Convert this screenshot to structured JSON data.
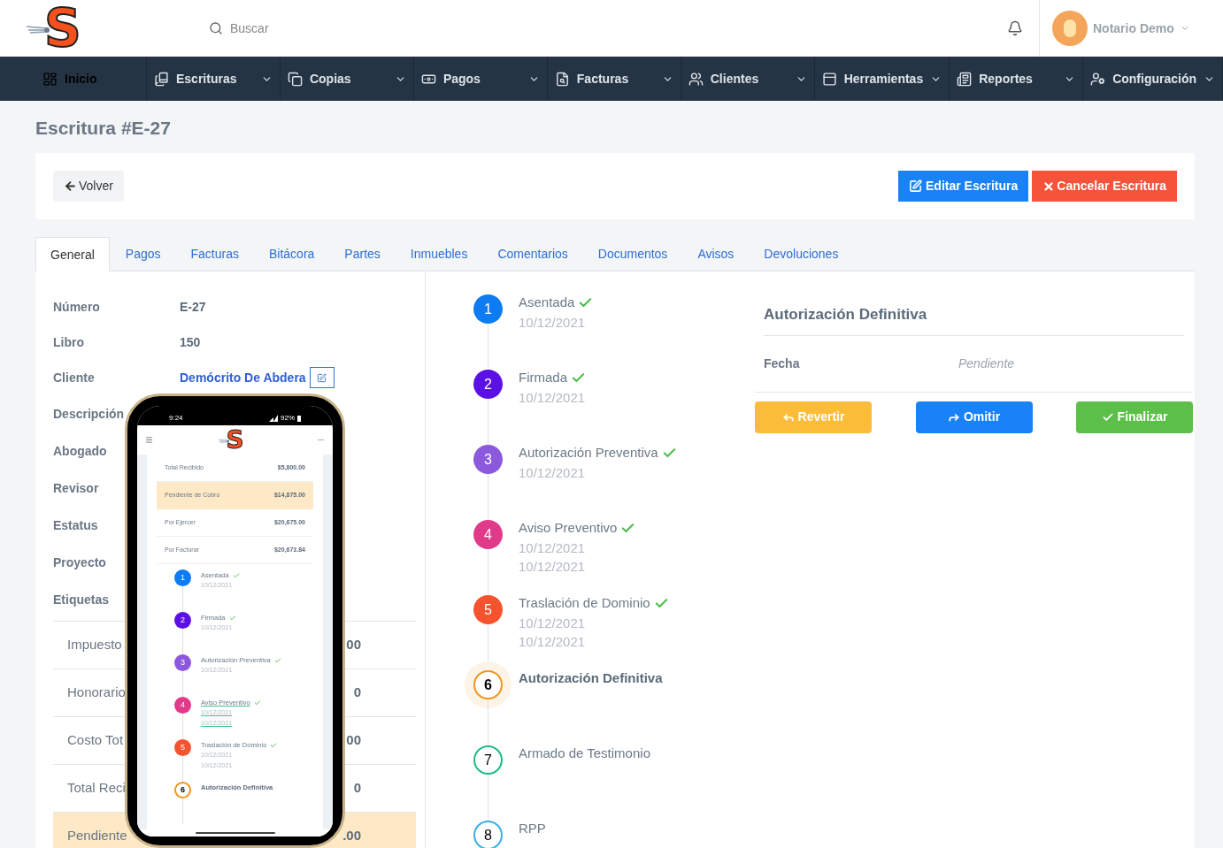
{
  "header": {
    "logo": "S",
    "search": {
      "placeholder": "Buscar"
    },
    "user": {
      "name": "Notario Demo"
    }
  },
  "nav": [
    {
      "label": "Inicio",
      "caret": false,
      "selected": true
    },
    {
      "label": "Escrituras",
      "caret": true,
      "selected": false
    },
    {
      "label": "Copias",
      "caret": true,
      "selected": false
    },
    {
      "label": "Pagos",
      "caret": true,
      "selected": false
    },
    {
      "label": "Facturas",
      "caret": true,
      "selected": false
    },
    {
      "label": "Clientes",
      "caret": true,
      "selected": false
    },
    {
      "label": "Herramientas",
      "caret": true,
      "selected": false
    },
    {
      "label": "Reportes",
      "caret": true,
      "selected": false
    },
    {
      "label": "Configuración",
      "caret": true,
      "selected": false
    }
  ],
  "page_title": "Escritura #E-27",
  "toolbar": {
    "back": "Volver",
    "edit": "Editar Escritura",
    "cancel": "Cancelar Escritura"
  },
  "tabs": [
    {
      "label": "General",
      "selected": true
    },
    {
      "label": "Pagos",
      "selected": false
    },
    {
      "label": "Facturas",
      "selected": false
    },
    {
      "label": "Bitácora",
      "selected": false
    },
    {
      "label": "Partes",
      "selected": false
    },
    {
      "label": "Inmuebles",
      "selected": false
    },
    {
      "label": "Comentarios",
      "selected": false
    },
    {
      "label": "Documentos",
      "selected": false
    },
    {
      "label": "Avisos",
      "selected": false
    },
    {
      "label": "Devoluciones",
      "selected": false
    }
  ],
  "details": [
    {
      "label": "Número",
      "value": "E-27",
      "kind": "text"
    },
    {
      "label": "Libro",
      "value": "150",
      "kind": "text"
    },
    {
      "label": "Cliente",
      "value": "Demócrito De Abdera",
      "kind": "link"
    },
    {
      "label": "Descripción",
      "kind": "empty"
    },
    {
      "label": "Abogado",
      "kind": "empty"
    },
    {
      "label": "Revisor",
      "kind": "empty"
    },
    {
      "label": "Estatus",
      "kind": "empty"
    },
    {
      "label": "Proyecto",
      "kind": "empty"
    },
    {
      "label": "Etiquetas",
      "kind": "empty"
    }
  ],
  "totals": [
    {
      "label": "Impuesto",
      "value": "00",
      "highlight": false
    },
    {
      "label": "Honorario",
      "value": "0",
      "highlight": false
    },
    {
      "label": "Costo Tot",
      "value": "00",
      "highlight": false
    },
    {
      "label": "Total Reci",
      "value": "0",
      "highlight": false
    },
    {
      "label": "Pendiente",
      "value": ".00",
      "highlight": true
    }
  ],
  "timeline": [
    {
      "number": "1",
      "title": "Asentada",
      "dates": [
        "10/12/2021"
      ],
      "done": true,
      "current": false,
      "filled": true,
      "color": "#0d7bf2"
    },
    {
      "number": "2",
      "title": "Firmada",
      "dates": [
        "10/12/2021"
      ],
      "done": true,
      "current": false,
      "filled": true,
      "color": "#5b10e6"
    },
    {
      "number": "3",
      "title": "Autorización Preventiva",
      "dates": [
        "10/12/2021"
      ],
      "done": true,
      "current": false,
      "filled": true,
      "color": "#8c58dc"
    },
    {
      "number": "4",
      "title": "Aviso Preventivo",
      "dates": [
        "10/12/2021",
        "10/12/2021"
      ],
      "done": true,
      "current": false,
      "filled": true,
      "color": "#e13a8b"
    },
    {
      "number": "5",
      "title": "Traslación de Dominio",
      "dates": [
        "10/12/2021",
        "10/12/2021"
      ],
      "done": true,
      "current": false,
      "filled": true,
      "color": "#f5532f"
    },
    {
      "number": "6",
      "title": "Autorización Definitiva",
      "done": false,
      "current": true,
      "filled": false,
      "color": "#f0961e"
    },
    {
      "number": "7",
      "title": "Armado de Testimonio",
      "done": false,
      "current": false,
      "filled": false,
      "color": "#1dbb8a"
    },
    {
      "number": "8",
      "title": "RPP",
      "done": false,
      "current": false,
      "filled": false,
      "color": "#3aaee5"
    }
  ],
  "step_panel": {
    "title": "Autorización Definitiva",
    "field_label": "Fecha",
    "field_value": "Pendiente",
    "buttons": [
      {
        "label": "Revertir",
        "kind": "revert"
      },
      {
        "label": "Omitir",
        "kind": "skip"
      },
      {
        "label": "Finalizar",
        "kind": "finish"
      }
    ]
  },
  "phone": {
    "time": "9:24",
    "battery": "92%",
    "logo": "S",
    "totals": [
      {
        "label": "Total Recibido",
        "value": "$5,800.00",
        "highlight": false
      },
      {
        "label": "Pendiente de Cobro",
        "value": "$14,875.00",
        "highlight": true
      },
      {
        "label": "Por Ejercer",
        "value": "$20,675.00",
        "highlight": false
      },
      {
        "label": "Por Facturar",
        "value": "$20,673.84",
        "highlight": false
      }
    ],
    "timeline": [
      {
        "number": "1",
        "title": "Asentada",
        "dates": [
          "10/12/2021"
        ],
        "done": true,
        "current": false,
        "underlined": false,
        "color": "#0d7bf2"
      },
      {
        "number": "2",
        "title": "Firmada",
        "dates": [
          "10/12/2021"
        ],
        "done": true,
        "current": false,
        "underlined": false,
        "color": "#5b10e6"
      },
      {
        "number": "3",
        "title": "Autorización Preventiva",
        "dates": [
          "10/12/2021"
        ],
        "done": true,
        "current": false,
        "underlined": false,
        "color": "#8c58dc"
      },
      {
        "number": "4",
        "title": "Aviso Preventivo",
        "dates": [
          "10/12/2021",
          "10/12/2021"
        ],
        "done": true,
        "current": false,
        "underlined": true,
        "color": "#e13a8b"
      },
      {
        "number": "5",
        "title": "Traslación de Dominio",
        "dates": [
          "10/12/2021",
          "10/12/2021"
        ],
        "done": true,
        "current": false,
        "underlined": false,
        "color": "#f5532f"
      },
      {
        "number": "6",
        "title": "Autorización Definitiva",
        "done": false,
        "current": true,
        "underlined": false,
        "color": "#f0961e"
      }
    ]
  }
}
